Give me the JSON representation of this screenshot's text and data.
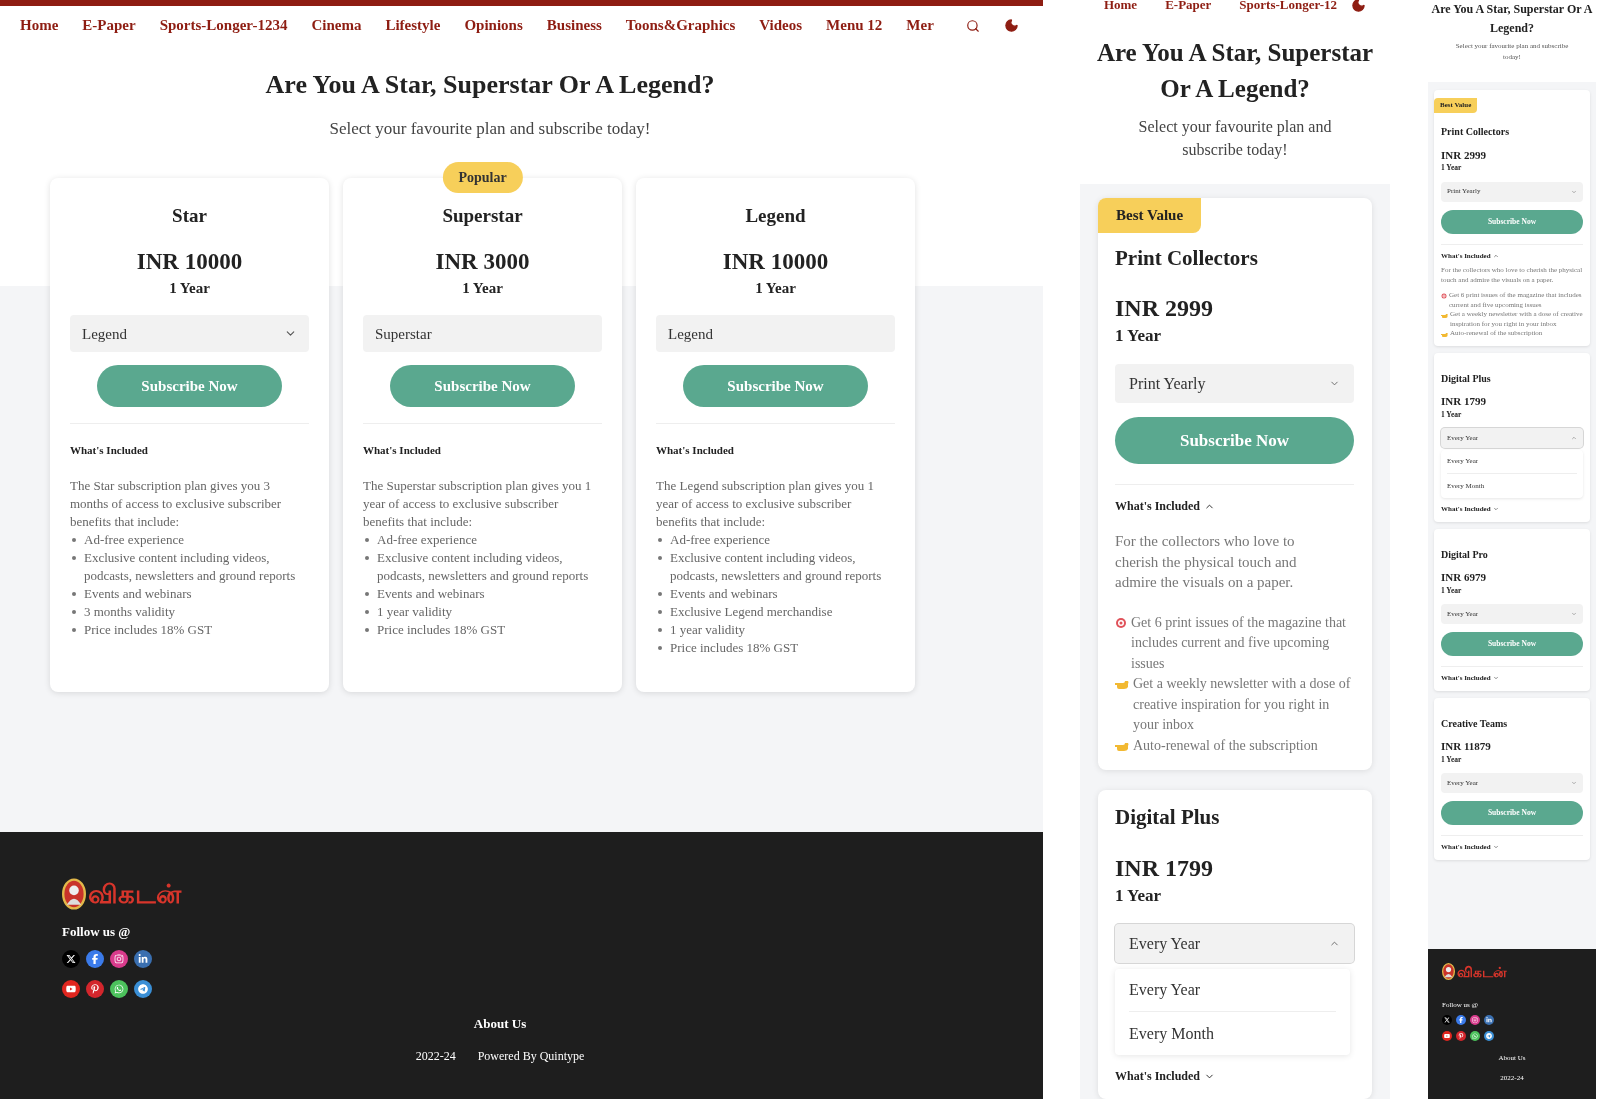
{
  "desktop": {
    "nav": {
      "items": [
        "Home",
        "E-Paper",
        "Sports-Longer-1234",
        "Cinema",
        "Lifestyle",
        "Opinions",
        "Business",
        "Toons&Graphics",
        "Videos",
        "Menu 12",
        "Mer"
      ]
    },
    "heading": "Are You A Star, Superstar Or A Legend?",
    "subheading": "Select your favourite plan and subscribe today!",
    "plans": [
      {
        "name": "Star",
        "price": "INR 10000",
        "period": "1 Year",
        "select": {
          "value": "Legend",
          "kind": "dropdown"
        },
        "button": "Subscribe Now",
        "included": "What's Included",
        "description": "The Star subscription plan gives you 3 months of access to exclusive subscriber benefits that include:",
        "features": [
          "Ad-free experience",
          "Exclusive content including videos, podcasts, newsletters and ground reports",
          "Events and webinars",
          "3 months validity",
          "Price includes 18% GST"
        ]
      },
      {
        "badge": "Popular",
        "name": "Superstar",
        "price": "INR 3000",
        "period": "1 Year",
        "select": {
          "value": "Superstar",
          "kind": "plain"
        },
        "button": "Subscribe Now",
        "included": "What's Included",
        "description": "The Superstar subscription plan gives you 1 year of access to exclusive subscriber benefits that include:",
        "features": [
          "Ad-free experience",
          "Exclusive content including videos, podcasts, newsletters and ground reports",
          "Events and webinars",
          "1 year validity",
          "Price includes 18% GST"
        ]
      },
      {
        "name": "Legend",
        "price": "INR 10000",
        "period": "1 Year",
        "select": {
          "value": "Legend",
          "kind": "plain"
        },
        "button": "Subscribe Now",
        "included": "What's Included",
        "description": "The Legend subscription plan gives you 1 year of access to exclusive subscriber benefits that include:",
        "features": [
          "Ad-free experience",
          "Exclusive content including videos, podcasts, newsletters and ground reports",
          "Events and webinars",
          "Exclusive Legend merchandise",
          "1 year validity",
          "Price includes 18% GST"
        ]
      }
    ],
    "footer": {
      "logo": "விகடன்",
      "follow": "Follow us @",
      "social": [
        {
          "kind": "x",
          "color": "#000000"
        },
        {
          "kind": "facebook",
          "color": "#3b7bea"
        },
        {
          "kind": "instagram",
          "color": "#d93b8c"
        },
        {
          "kind": "linkedin",
          "color": "#3a6fb0"
        },
        {
          "kind": "youtube",
          "color": "#e0261f"
        },
        {
          "kind": "pinterest",
          "color": "#d3262c"
        },
        {
          "kind": "whatsapp",
          "color": "#4cc25c"
        },
        {
          "kind": "telegram",
          "color": "#3a8fd6"
        }
      ],
      "about": "About Us",
      "year": "2022-24",
      "powered": "Powered By Quintype"
    }
  },
  "tablet": {
    "nav": {
      "items": [
        "Home",
        "E-Paper",
        "Sports-Longer-12"
      ]
    },
    "heading": "Are You A Star, Superstar Or A Legend?",
    "subheading": "Select your favourite plan and subscribe today!",
    "plans": [
      {
        "badge": "Best Value",
        "name": "Print Collectors",
        "price": "INR 2999",
        "period": "1 Year",
        "select": {
          "value": "Print Yearly",
          "expanded": false
        },
        "button": "Subscribe Now",
        "included": {
          "label": "What's Included",
          "expanded": true
        },
        "description": "For the collectors who love to cherish the physical touch and admire the visuals on a paper.",
        "features": [
          {
            "kind": "target",
            "text": "Get 6 print issues of the magazine that includes current and five upcoming issues"
          },
          {
            "kind": "hand",
            "text": "Get a weekly newsletter with a dose of creative inspiration for you right in your inbox"
          },
          {
            "kind": "hand",
            "text": "Auto-renewal of the subscription"
          }
        ]
      },
      {
        "name": "Digital Plus",
        "price": "INR 1799",
        "period": "1 Year",
        "select": {
          "value": "Every Year",
          "expanded": true,
          "options": [
            "Every Year",
            "Every Month"
          ]
        },
        "included": {
          "label": "What's Included",
          "expanded": false
        }
      }
    ]
  },
  "mobile": {
    "heading": "Are You A Star, Superstar Or A Legend?",
    "subheading": "Select your favourite plan and subscribe today!",
    "plans": [
      {
        "badge": "Best Value",
        "name": "Print Collectors",
        "price": "INR 2999",
        "period": "1 Year",
        "select": {
          "value": "Print Yearly",
          "expanded": false
        },
        "button": "Subscribe Now",
        "included": {
          "label": "What's Included",
          "expanded": true
        },
        "description": "For the collectors who love to cherish the physical touch and admire the visuals on a paper.",
        "features": [
          {
            "kind": "target",
            "text": "Get 6 print issues of the magazine that includes current and five upcoming issues"
          },
          {
            "kind": "hand",
            "text": "Get a weekly newsletter with a dose of creative inspiration for you right in your inbox"
          },
          {
            "kind": "hand",
            "text": "Auto-renewal of the subscription"
          }
        ]
      },
      {
        "name": "Digital Plus",
        "price": "INR 1799",
        "period": "1 Year",
        "select": {
          "value": "Every Year",
          "expanded": true,
          "options": [
            "Every Year",
            "Every Month"
          ]
        },
        "included": {
          "label": "What's Included",
          "expanded": false
        }
      },
      {
        "name": "Digital Pro",
        "price": "INR 6979",
        "period": "1 Year",
        "select": {
          "value": "Every Year",
          "expanded": false
        },
        "button": "Subscribe Now",
        "included": {
          "label": "What's Included",
          "expanded": false
        }
      },
      {
        "name": "Creative Teams",
        "price": "INR 11879",
        "period": "1 Year",
        "select": {
          "value": "Every Year",
          "expanded": false
        },
        "button": "Subscribe Now",
        "included": {
          "label": "What's Included",
          "expanded": false
        }
      }
    ],
    "footer": {
      "logo": "விகடன்",
      "follow": "Follow us @",
      "social": [
        {
          "kind": "x",
          "color": "#000000"
        },
        {
          "kind": "facebook",
          "color": "#3b7bea"
        },
        {
          "kind": "instagram",
          "color": "#d93b8c"
        },
        {
          "kind": "linkedin",
          "color": "#3a6fb0"
        },
        {
          "kind": "youtube",
          "color": "#e0261f"
        },
        {
          "kind": "pinterest",
          "color": "#d3262c"
        },
        {
          "kind": "whatsapp",
          "color": "#4cc25c"
        },
        {
          "kind": "telegram",
          "color": "#3a8fd6"
        }
      ],
      "about": "About Us",
      "year": "2022-24"
    }
  }
}
